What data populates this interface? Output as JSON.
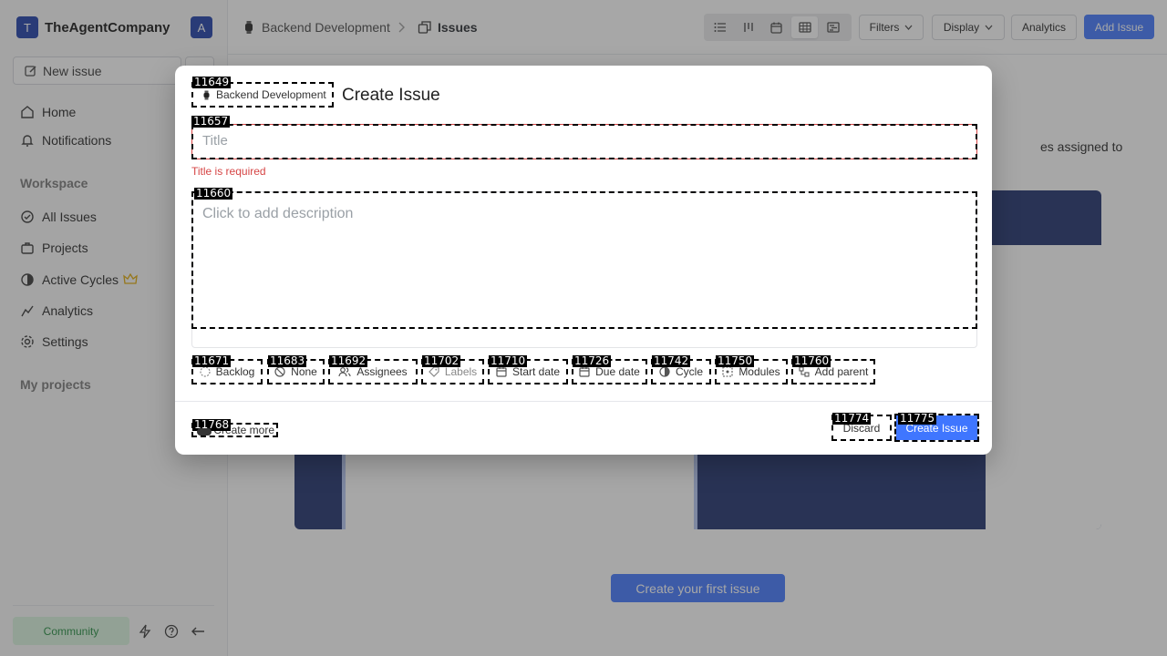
{
  "colors": {
    "brand": "#1a3ba8",
    "primary": "#3f76ff",
    "error": "#d64545",
    "community_bg": "#d9f5df"
  },
  "workspace": {
    "logo_letter": "T",
    "name": "TheAgentCompany",
    "user_initial": "A"
  },
  "sidebar": {
    "new_issue_label": "New issue",
    "top_items": [
      {
        "label": "Home",
        "icon": "home-icon"
      },
      {
        "label": "Notifications",
        "icon": "bell-icon"
      }
    ],
    "workspace_title": "Workspace",
    "workspace_items": [
      {
        "label": "All Issues",
        "icon": "check-circle-icon"
      },
      {
        "label": "Projects",
        "icon": "briefcase-icon"
      },
      {
        "label": "Active Cycles",
        "icon": "cycle-icon"
      },
      {
        "label": "Analytics",
        "icon": "chart-icon"
      },
      {
        "label": "Settings",
        "icon": "gear-icon"
      }
    ],
    "my_projects_title": "My projects",
    "community_label": "Community"
  },
  "header": {
    "breadcrumb_project": "Backend Development",
    "breadcrumb_page": "Issues",
    "filters_label": "Filters",
    "display_label": "Display",
    "analytics_label": "Analytics",
    "add_issue_label": "Add Issue"
  },
  "main": {
    "partial_text": "es assigned to",
    "cta_label": "Create your first issue"
  },
  "modal": {
    "project_tag": "11649",
    "project_name": "Backend Development",
    "title": "Create Issue",
    "title_tag": "11657",
    "title_placeholder": "Title",
    "title_error": "Title is required",
    "desc_tag": "11660",
    "desc_placeholder": "Click to add description",
    "properties": [
      {
        "tag": "11671",
        "label": "Backlog",
        "icon": "backlog-icon"
      },
      {
        "tag": "11683",
        "label": "None",
        "icon": "priority-icon"
      },
      {
        "tag": "11692",
        "label": "Assignees",
        "icon": "users-icon"
      },
      {
        "tag": "11702",
        "label": "Labels",
        "icon": "tag-icon"
      },
      {
        "tag": "11710",
        "label": "Start date",
        "icon": "calendar-icon"
      },
      {
        "tag": "11726",
        "label": "Due date",
        "icon": "calendar-icon"
      },
      {
        "tag": "11742",
        "label": "Cycle",
        "icon": "cycle-icon"
      },
      {
        "tag": "11750",
        "label": "Modules",
        "icon": "modules-icon"
      },
      {
        "tag": "11760",
        "label": "Add parent",
        "icon": "parent-icon"
      }
    ],
    "create_more_tag": "11768",
    "create_more_label": "Create more",
    "discard_tag": "11774",
    "discard_label": "Discard",
    "create_tag": "11775",
    "create_label": "Create Issue"
  }
}
